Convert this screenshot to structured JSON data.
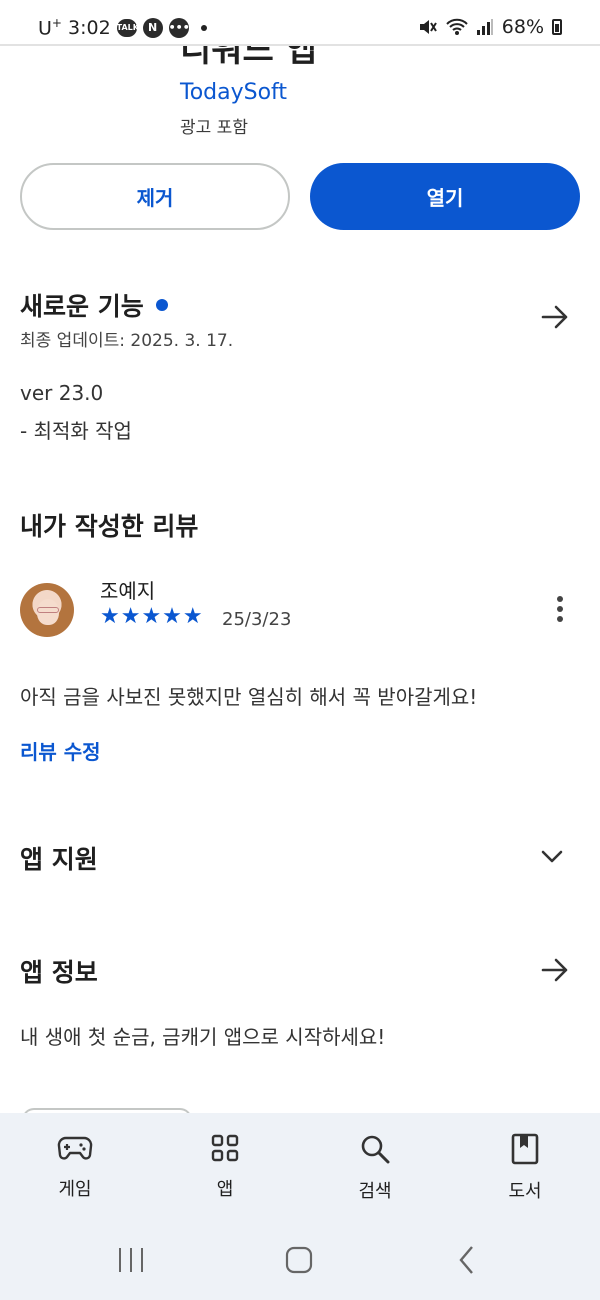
{
  "status_bar": {
    "carrier": "U",
    "carrier_sup": "+",
    "time": "3:02",
    "notif_icons": [
      "talk-icon",
      "naver-icon",
      "message-icon"
    ],
    "battery": "68%"
  },
  "app": {
    "title_fragment": "디워드 앱",
    "developer": "TodaySoft",
    "ads_label": "광고 포함"
  },
  "buttons": {
    "remove": "제거",
    "open": "열기"
  },
  "whats_new": {
    "title": "새로운 기능",
    "last_updated": "최종 업데이트: 2025. 3. 17.",
    "version": "ver 23.0",
    "note": "- 최적화 작업"
  },
  "my_review": {
    "title": "내가 작성한 리뷰",
    "reviewer": "조예지",
    "stars": "★★★★★",
    "rating": 5,
    "date": "25/3/23",
    "text": "아직 금을 사보진 못했지만 열심히 해서 꼭 받아갈게요!",
    "edit_link": "리뷰 수정"
  },
  "app_support": {
    "title": "앱 지원"
  },
  "about": {
    "title": "앱 정보",
    "description": "내 생애 첫 순금, 금캐기 앱으로 시작하세요!"
  },
  "bottom_nav": [
    {
      "label": "게임",
      "icon": "gamepad-icon"
    },
    {
      "label": "앱",
      "icon": "apps-grid-icon"
    },
    {
      "label": "검색",
      "icon": "search-icon"
    },
    {
      "label": "도서",
      "icon": "book-icon"
    }
  ],
  "colors": {
    "accent": "#0b57d0",
    "nav_bg": "#eef2f7"
  }
}
